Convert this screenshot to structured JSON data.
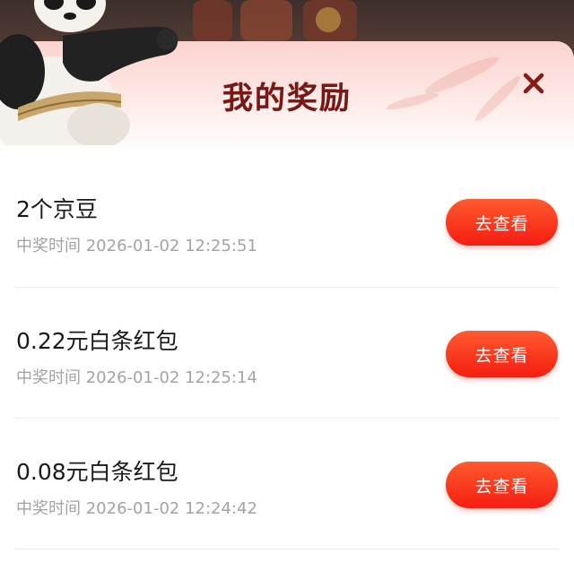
{
  "modal": {
    "title": "我的奖励",
    "close_icon": "close-icon",
    "accent_color": "#f51d12",
    "title_color": "#7a1712"
  },
  "rewards": [
    {
      "name": "2个京豆",
      "time_label": "中奖时间",
      "time": "2026-01-02 12:25:51",
      "button": "去查看"
    },
    {
      "name": "0.22元白条红包",
      "time_label": "中奖时间",
      "time": "2026-01-02 12:25:14",
      "button": "去查看"
    },
    {
      "name": "0.08元白条红包",
      "time_label": "中奖时间",
      "time": "2026-01-02 12:24:42",
      "button": "去查看"
    }
  ]
}
